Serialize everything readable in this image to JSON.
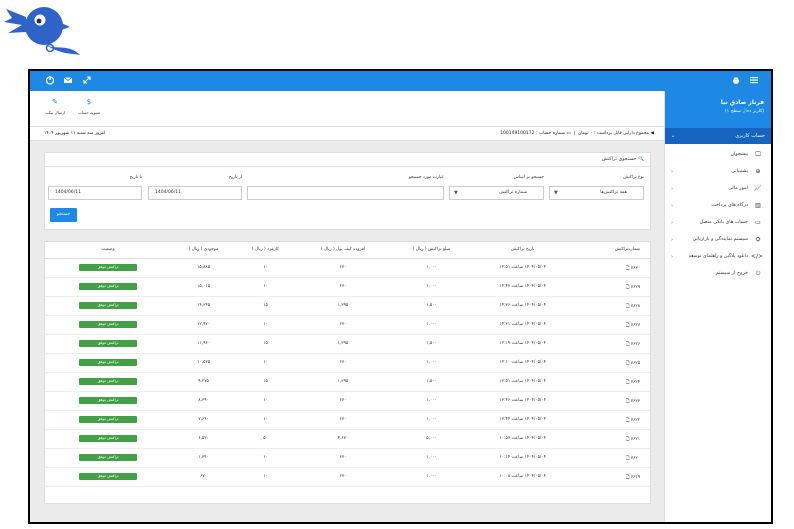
{
  "topbar": {
    "icons": [
      "power-icon",
      "mail-icon",
      "expand-icon"
    ],
    "menu_icon": "hamburger-icon"
  },
  "sidebar": {
    "user_name": "فرناز صادق نیا",
    "user_status_prefix": "(کاربر",
    "user_status_value": "فعال",
    "user_status_suffix": "سطح ۱)",
    "account_label": "حساب کاربری",
    "items": [
      {
        "label": "پیشخوان",
        "icon": "monitor-icon"
      },
      {
        "label": "پشتیبانی",
        "icon": "support-icon"
      },
      {
        "label": "امور مالی",
        "icon": "chart-icon"
      },
      {
        "label": "درگاه های پرداخت",
        "icon": "barcode-icon"
      },
      {
        "label": "حساب های بانکی متصل",
        "icon": "card-icon"
      },
      {
        "label": "سیستم نمایندگی و بازاریابی",
        "icon": "sitemap-icon"
      },
      {
        "label": "دانلود پلاگین و راهنمای توسعه",
        "icon": "code-icon"
      },
      {
        "label": "خروج از سیستم",
        "icon": "power-icon"
      }
    ]
  },
  "toolbar": {
    "settle_label": "تسویه حساب",
    "ticket_label": "ارسال تیکت"
  },
  "infobar": {
    "balance_text": "مجموع دارایی قابل برداشت : ۰ تومان",
    "account_text": "شماره حساب : 100149100172",
    "date_text": "امروز سه شنبه ۱۱ شهریور ۱۴۰۴"
  },
  "search": {
    "title": "جستجوی تراکنش",
    "type_label": "نوع تراکنش",
    "type_value": "همه تراکنش‌ها",
    "basis_label": "جستجو بر اساس",
    "basis_value": "شماره تراکنش",
    "phrase_label": "عبارت مورد جستجو",
    "phrase_value": "",
    "from_label": "از تاریخ",
    "from_value": "1404/06/11",
    "to_label": "تا تاریخ",
    "to_value": "1404/06/11",
    "button": "جستجو"
  },
  "table": {
    "headers": [
      "شماره‌تراکنش",
      "تاریخ تراکنش",
      "مبلغ تراکنش ( ریال )",
      "افزوده کیف پول ( ریال )",
      "کارمزد ( ریال )",
      "موجودی ( ریال )",
      "وضعیت"
    ],
    "status_label": "تراکنش موفق",
    "rows": [
      [
        "۷۶۳۰ 🗋",
        "۱۴۰۴/۰۵/۰۴ ساعت ۱۴:۵۱",
        "۱,۰۰۰",
        "۶۷۰",
        "۱۰",
        "۱۵,۸۸۵"
      ],
      [
        "۷۶۲۹ 🗋",
        "۱۴۰۴/۰۵/۰۴ ساعت ۱۴:۴۷",
        "۱,۰۰۰",
        "۶۷۰",
        "۱۰",
        "۱۵,۰۱۵"
      ],
      [
        "۷۶۲۸ 🗋",
        "۱۴۰۴/۰۵/۰۴ ساعت ۱۴:۳۶",
        "۱,۵۰۰",
        "۱,۳۹۵",
        "۱۵",
        "۱۴,۳۴۵"
      ],
      [
        "۷۶۲۷ 🗋",
        "۱۴۰۴/۰۵/۰۴ ساعت ۱۴:۳۱",
        "۱,۰۰۰",
        "۶۷۰",
        "۱۰",
        "۱۲,۹۷۰"
      ],
      [
        "۷۶۲۶ 🗋",
        "۱۴۰۴/۰۵/۰۴ ساعت ۱۴:۱۹",
        "۱,۵۰۰",
        "۱,۳۹۵",
        "۱۵",
        "۱۱,۹۶۰"
      ],
      [
        "۷۶۲۵ 🗋",
        "۱۴۰۴/۰۵/۰۴ ساعت ۱۴:۱۰",
        "۱,۰۰۰",
        "۶۷۰",
        "۱۰",
        "۱۰,۵۳۵"
      ],
      [
        "۷۶۲۴ 🗋",
        "۱۴۰۴/۰۵/۰۴ ساعت ۱۳:۵۱",
        "۱,۵۰۰",
        "۱,۳۹۵",
        "۱۵",
        "۹,۲۷۵"
      ],
      [
        "۷۶۲۳ 🗋",
        "۱۴۰۴/۰۵/۰۴ ساعت ۱۳:۴۶",
        "۱,۰۰۰",
        "۶۷۰",
        "۱۰",
        "۸,۳۹۰"
      ],
      [
        "۷۶۲۲ 🗋",
        "۱۴۰۴/۰۵/۰۴ ساعت ۱۳:۴۴",
        "۱,۰۰۰",
        "۶۷۰",
        "۱۰",
        "۷,۶۴۰"
      ],
      [
        "۷۶۲۱ 🗋",
        "۱۴۰۴/۰۵/۰۴ ساعت ۱۰:۵۷",
        "۵,۰۰۰",
        "۴,۶۷۰",
        "۵۰",
        "۶,۵۲۰"
      ],
      [
        "۷۶۲۰ 🗋",
        "۱۴۰۴/۰۵/۰۴ ساعت ۱۰:۱۴",
        "۱,۰۰۰",
        "۶۷۰",
        "۱۰",
        "۱,۳۴۰"
      ],
      [
        "۷۶۱۹ 🗋",
        "۱۴۰۴/۰۵/۰۴ ساعت ۱۰:۰۸",
        "۱,۰۰۰",
        "۶۷۰",
        "۱۰",
        "۶۷۰"
      ]
    ]
  },
  "colors": {
    "primary": "#1e88e5",
    "success": "#43a047"
  }
}
